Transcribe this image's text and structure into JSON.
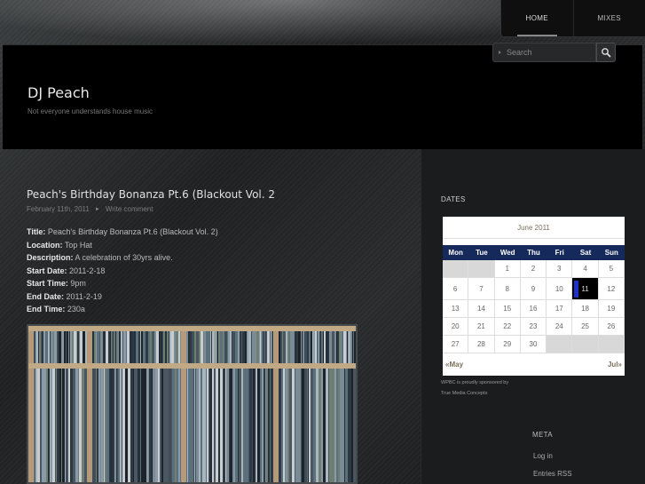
{
  "nav": {
    "items": [
      {
        "label": "HOME",
        "active": true
      },
      {
        "label": "MIXES",
        "active": false
      }
    ]
  },
  "header": {
    "site_title": "DJ Peach",
    "tagline": "Not everyone understands house music",
    "search": {
      "placeholder": "Search",
      "icon": "search-icon"
    }
  },
  "post": {
    "title": "Peach's Birthday Bonanza Pt.6 (Blackout Vol. 2",
    "date": "February 11th, 2011",
    "comment_link": "Write comment",
    "details": [
      {
        "label": "Title:",
        "value": "Peach's Birthday Bonanza Pt.6 (Blackout Vol. 2)"
      },
      {
        "label": "Location:",
        "value": "Top Hat"
      },
      {
        "label": "Description:",
        "value": "A celebration of 30yrs alive."
      },
      {
        "label": "Start Date:",
        "value": "2011-2-18"
      },
      {
        "label": "Start Time:",
        "value": "9pm"
      },
      {
        "label": "End Date:",
        "value": "2011-2-19"
      },
      {
        "label": "End Time:",
        "value": "230a"
      }
    ]
  },
  "sidebar": {
    "dates_heading": "DATES",
    "calendar": {
      "month_label": "June 2011",
      "weekdays": [
        "Mon",
        "Tue",
        "Wed",
        "Thu",
        "Fri",
        "Sat",
        "Sun"
      ],
      "weeks": [
        [
          "",
          "",
          "1",
          "2",
          "3",
          "4",
          "5"
        ],
        [
          "6",
          "7",
          "8",
          "9",
          "10",
          "11",
          "12"
        ],
        [
          "13",
          "14",
          "15",
          "16",
          "17",
          "18",
          "19"
        ],
        [
          "20",
          "21",
          "22",
          "23",
          "24",
          "25",
          "26"
        ],
        [
          "27",
          "28",
          "29",
          "30",
          "",
          "",
          ""
        ]
      ],
      "today": "11",
      "prev_link": "«May",
      "next_link": "Jul»"
    },
    "sponsor_line1": "WPBC is proudly sponsored by",
    "sponsor_line2": "True Media Concepts",
    "meta_heading": "META",
    "meta_links": [
      "Log in",
      "Entries RSS"
    ]
  },
  "colors": {
    "calendar_header_bg": "#15295a",
    "today_marker": "#1d32c8",
    "header_bg": "#000000"
  }
}
